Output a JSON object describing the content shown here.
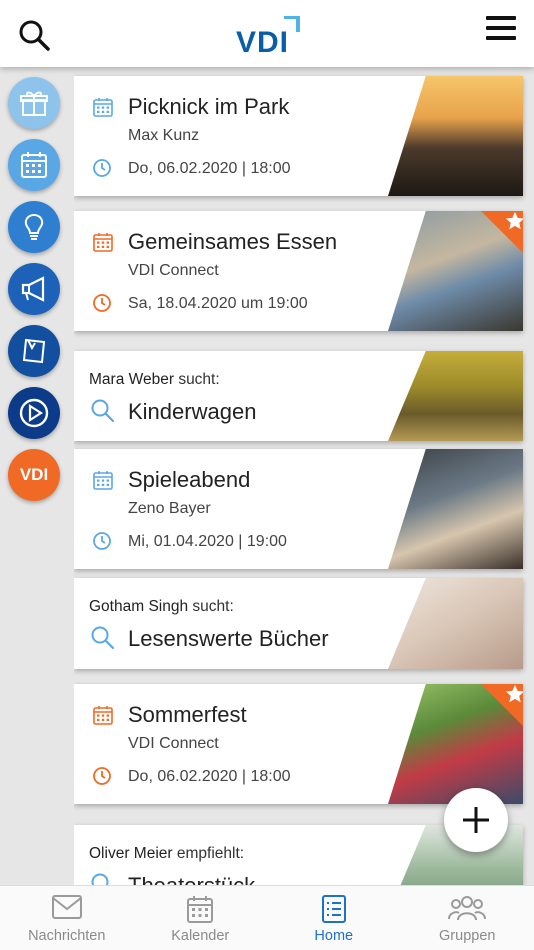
{
  "header": {
    "logo_text": "VDI",
    "search_icon": "search-icon",
    "menu_icon": "menu-icon"
  },
  "rail": [
    {
      "name": "gift-icon",
      "bg": "#8ec3ec"
    },
    {
      "name": "calendar-icon",
      "bg": "#5aa7e6"
    },
    {
      "name": "lightbulb-icon",
      "bg": "#2f7fd0"
    },
    {
      "name": "megaphone-icon",
      "bg": "#1d62b8"
    },
    {
      "name": "bookmark-tag-icon",
      "bg": "#134f9f"
    },
    {
      "name": "play-icon",
      "bg": "#0c3b8a"
    },
    {
      "name": "vdi-logo-icon",
      "bg": "#f06a25",
      "label": "VDI"
    }
  ],
  "cards": [
    {
      "type": "event",
      "title": "Picknick im Park",
      "organizer": "Max Kunz",
      "datetime": "Do, 06.02.2020 | 18:00",
      "accent": "#5aa7e6",
      "featured": false
    },
    {
      "type": "event",
      "title": "Gemeinsames Essen",
      "organizer": "VDI Connect",
      "datetime": "Sa, 18.04.2020 um 19:00",
      "accent": "#f06a25",
      "featured": true
    },
    {
      "type": "search",
      "person": "Mara Weber",
      "verb": "sucht:",
      "title": "Kinderwagen",
      "accent": "#5aa7e6"
    },
    {
      "type": "event",
      "title": "Spieleabend",
      "organizer": "Zeno Bayer",
      "datetime": "Mi, 01.04.2020 | 19:00",
      "accent": "#5aa7e6",
      "featured": false
    },
    {
      "type": "search",
      "person": "Gotham Singh",
      "verb": "sucht:",
      "title": "Lesenswerte Bücher",
      "accent": "#5aa7e6"
    },
    {
      "type": "event",
      "title": "Sommerfest",
      "organizer": "VDI Connect",
      "datetime": "Do, 06.02.2020 | 18:00",
      "accent": "#f06a25",
      "featured": true
    },
    {
      "type": "recommend",
      "person": "Oliver Meier",
      "verb": "empfiehlt:",
      "title": "Theaterstück",
      "accent": "#5aa7e6"
    }
  ],
  "tabs": [
    {
      "label": "Nachrichten",
      "icon": "mail-icon",
      "active": false
    },
    {
      "label": "Kalender",
      "icon": "calendar-icon",
      "active": false
    },
    {
      "label": "Home",
      "icon": "list-icon",
      "active": true
    },
    {
      "label": "Gruppen",
      "icon": "group-icon",
      "active": false
    }
  ]
}
